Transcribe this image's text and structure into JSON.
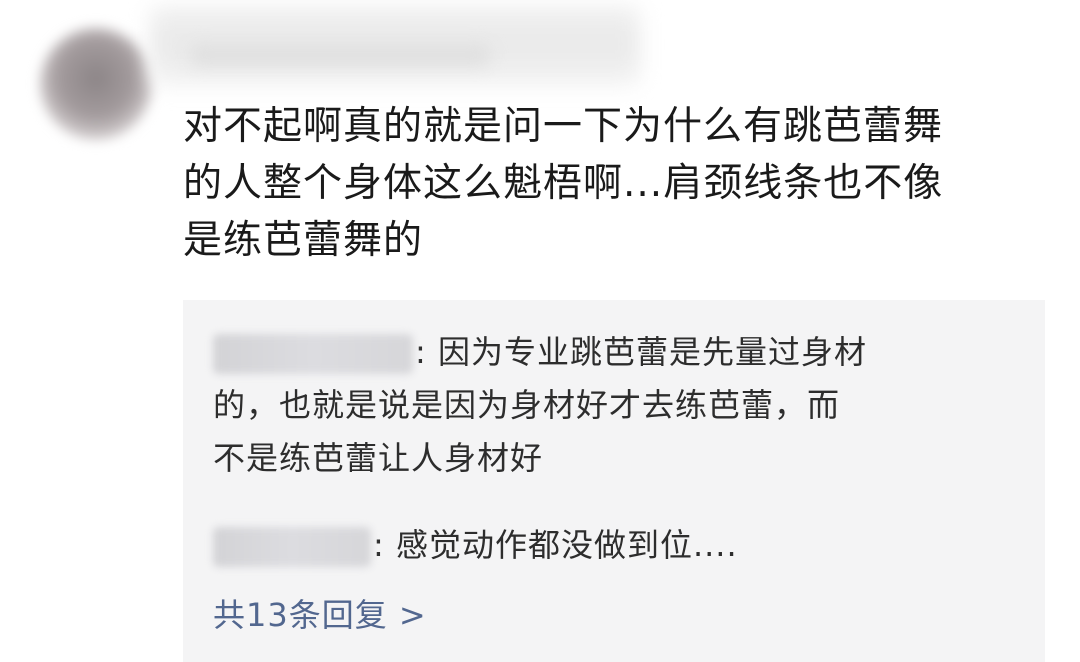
{
  "comment": {
    "lines": [
      "对不起啊真的就是问一下为什么有跳芭蕾舞",
      "的人整个身体这么魁梧啊...肩颈线条也不像",
      "是练芭蕾舞的"
    ]
  },
  "replies": [
    {
      "separator": ":",
      "lines": [
        "因为专业跳芭蕾是先量过身材",
        "的，也就是说是因为身材好才去练芭蕾，而",
        "不是练芭蕾让人身材好"
      ]
    },
    {
      "separator": ":",
      "lines": [
        "感觉动作都没做到位...."
      ]
    }
  ],
  "more_replies": {
    "label": "共13条回复 >"
  },
  "colors": {
    "link": "#52678f",
    "reply_background": "#f4f4f5",
    "text": "#1a1a1a"
  }
}
